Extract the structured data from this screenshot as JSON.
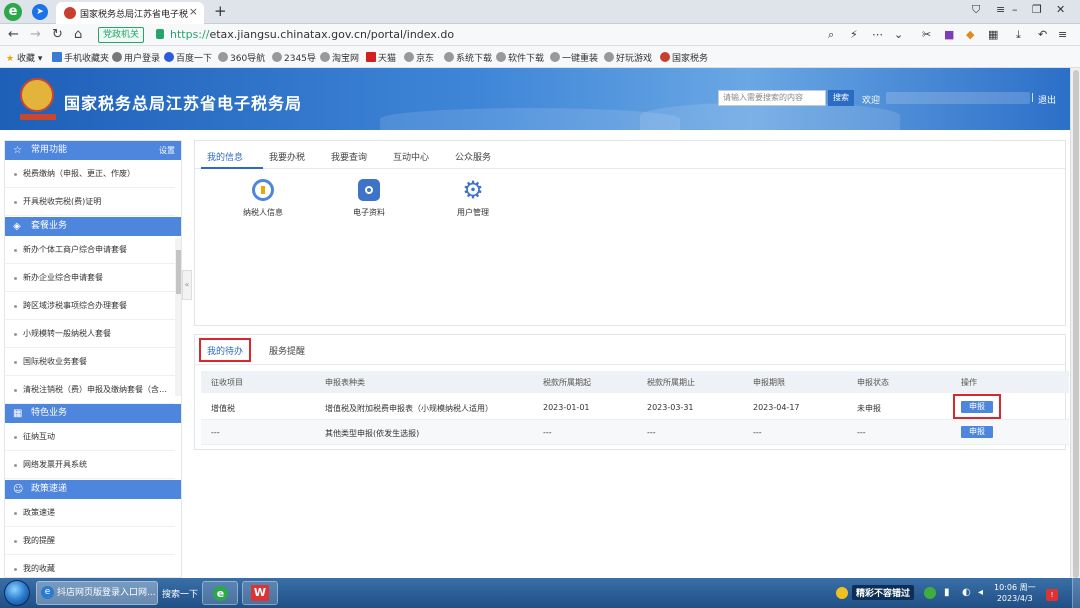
{
  "browser": {
    "tab_title": "国家税务总局江苏省电子税务",
    "gov_badge": "党政机关",
    "url_scheme": "https://",
    "url_rest": "etax.jiangsu.chinatax.gov.cn/portal/index.do"
  },
  "bookmarks": [
    "收藏",
    "手机收藏夹",
    "用户登录",
    "百度一下",
    "360导航",
    "2345导",
    "淘宝网",
    "天猫",
    "京东",
    "系统下载",
    "软件下载",
    "一键重装",
    "好玩游戏",
    "国家税务"
  ],
  "header": {
    "title": "国家税务总局江苏省电子税务局",
    "search_placeholder": "请输入需要搜索的内容",
    "search_button": "搜索",
    "welcome": "欢迎",
    "logout": "退出",
    "separator": "|"
  },
  "sidebar": {
    "common": {
      "title": "常用功能",
      "settings": "设置",
      "items": [
        "税费缴纳（申报、更正、作废）",
        "开具税收完税(费)证明"
      ]
    },
    "package": {
      "title": "套餐业务",
      "items": [
        "新办个体工商户综合申请套餐",
        "新办企业综合申请套餐",
        "跨区域涉税事项综合办理套餐",
        "小规模转一般纳税人套餐",
        "国际税收业务套餐",
        "清税注销税（费）申报及缴纳套餐（含…"
      ]
    },
    "special": {
      "title": "特色业务",
      "items": [
        "征纳互动",
        "网络发票开具系统"
      ]
    },
    "policy": {
      "title": "政策速递",
      "items": [
        "政策速递",
        "我的提醒",
        "我的收藏"
      ]
    }
  },
  "top_panel": {
    "tabs": [
      "我的信息",
      "我要办税",
      "我要查询",
      "互动中心",
      "公众服务"
    ],
    "quick": [
      {
        "label": "纳税人信息",
        "icon": "taxpayer-info-icon"
      },
      {
        "label": "电子资料",
        "icon": "folder-icon"
      },
      {
        "label": "用户管理",
        "icon": "gear-icon"
      }
    ]
  },
  "todo_panel": {
    "tabs": [
      "我的待办",
      "服务提醒"
    ],
    "columns": [
      "征收项目",
      "申报表种类",
      "税款所属期起",
      "税款所属期止",
      "申报期限",
      "申报状态",
      "操作"
    ],
    "rows": [
      [
        "增值税",
        "增值税及附加税费申报表（小规模纳税人适用）",
        "2023-01-01",
        "2023-03-31",
        "2023-04-17",
        "未申报",
        "申报"
      ],
      [
        "---",
        "其他类型申报(依发生选报)",
        "---",
        "---",
        "---",
        "---",
        "申报"
      ]
    ]
  },
  "taskbar": {
    "app1": "抖店网页版登录入口网...",
    "search": "搜索一下",
    "tray_text": "精彩不容错过",
    "time": "10:06 周一",
    "date": "2023/4/3"
  },
  "colors": {
    "accent": "#2a6bc4",
    "sidebar_head": "#4f86dd",
    "highlight_red": "#d9272e"
  }
}
